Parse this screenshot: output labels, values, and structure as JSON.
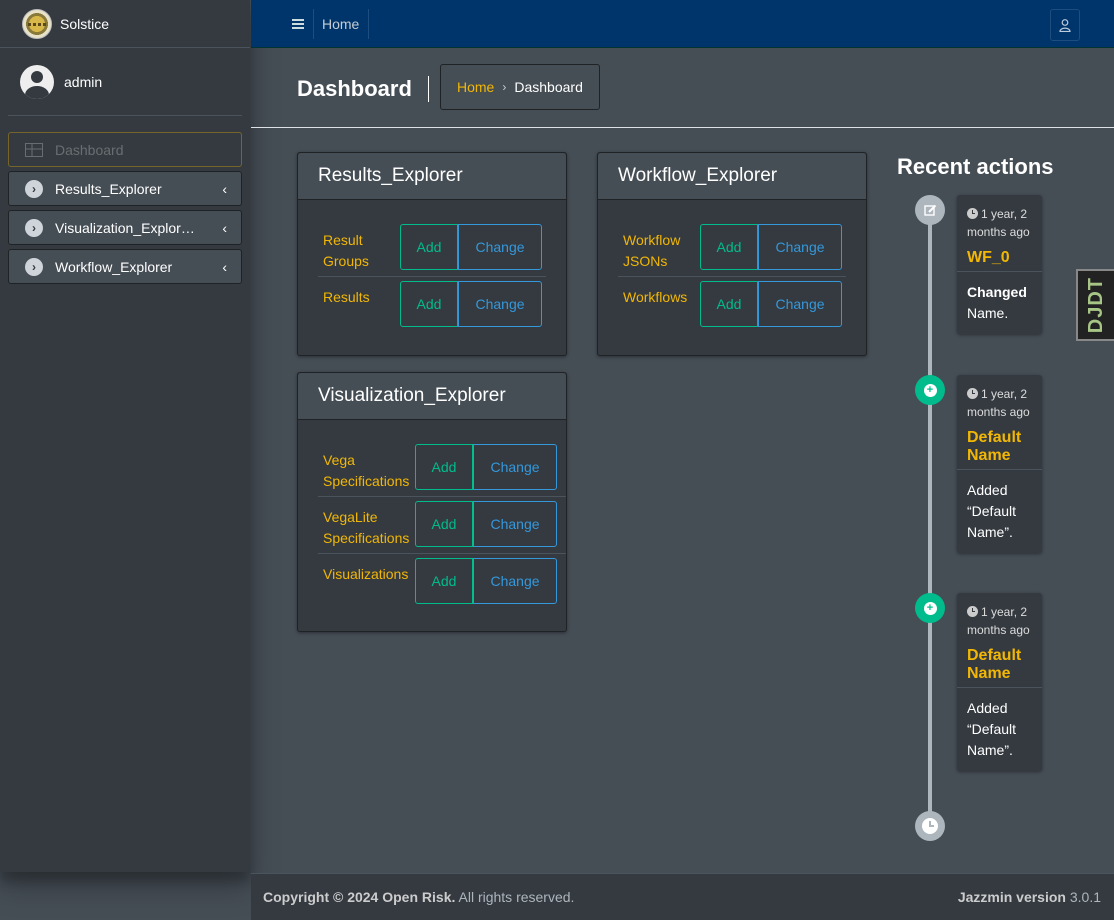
{
  "brand": {
    "name": "Solstice"
  },
  "user": {
    "name": "admin"
  },
  "sidebar": {
    "items": [
      {
        "label": "Dashboard",
        "icon": "dashboard-icon",
        "active": true
      },
      {
        "label": "Results_Explorer",
        "icon": "chevron-circle-right-icon"
      },
      {
        "label": "Visualization_Explor…",
        "icon": "chevron-circle-right-icon"
      },
      {
        "label": "Workflow_Explorer",
        "icon": "chevron-circle-right-icon"
      }
    ]
  },
  "topbar": {
    "home_label": "Home"
  },
  "content_header": {
    "title": "Dashboard",
    "breadcrumb": {
      "home": "Home",
      "separator": "›",
      "current": "Dashboard"
    }
  },
  "buttons": {
    "add": "Add",
    "change": "Change"
  },
  "apps": [
    {
      "title": "Results_Explorer",
      "models": [
        "Result Groups",
        "Results"
      ]
    },
    {
      "title": "Workflow_Explorer",
      "models": [
        "Workflow JSONs",
        "Workflows"
      ]
    },
    {
      "title": "Visualization_Explorer",
      "models": [
        "Vega Specifications",
        "VegaLite Specifications",
        "Visualizations"
      ]
    }
  ],
  "recent_actions": {
    "title": "Recent actions",
    "items": [
      {
        "time": "1 year, 2 months ago",
        "object": "WF_0",
        "desc_bold": "Changed",
        "desc": "Name.",
        "type": "change"
      },
      {
        "time": "1 year, 2 months ago",
        "object": "Default Name",
        "desc_bold": "",
        "desc": "Added “Default Name”.",
        "type": "add"
      },
      {
        "time": "1 year, 2 months ago",
        "object": "Default Name",
        "desc_bold": "",
        "desc": "Added “Default Name”.",
        "type": "add"
      }
    ]
  },
  "djdt": {
    "label": "DJDT"
  },
  "footer": {
    "copyright_bold": "Copyright © 2024 Open Risk.",
    "copyright_rest": " All rights reserved.",
    "version_bold": "Jazzmin version",
    "version": " 3.0.1"
  },
  "colors": {
    "accent": "#f2b705",
    "header": "#00356b",
    "success": "#00bc8c",
    "info": "#3498db"
  }
}
